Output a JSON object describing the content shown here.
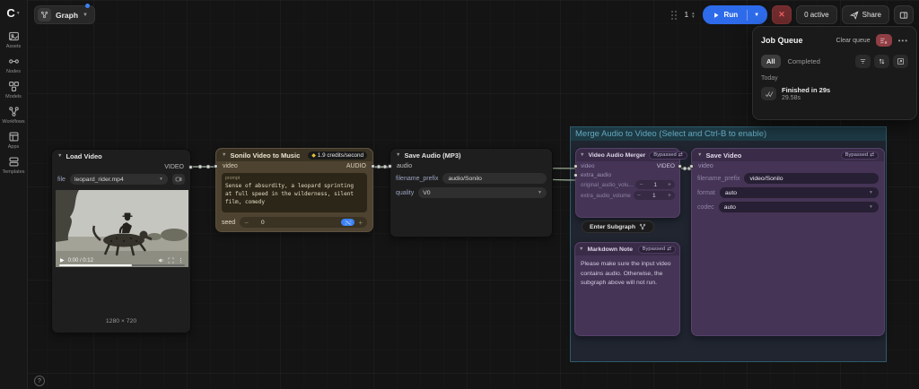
{
  "topbar": {
    "graph_tab": "Graph",
    "batch_count": "1",
    "run_label": "Run",
    "active_label": "0 active",
    "share_label": "Share"
  },
  "sidebar": {
    "items": [
      {
        "label": "Assets"
      },
      {
        "label": "Nodes"
      },
      {
        "label": "Models"
      },
      {
        "label": "Workflows"
      },
      {
        "label": "Apps"
      },
      {
        "label": "Templates"
      }
    ]
  },
  "job_queue": {
    "title": "Job Queue",
    "clear_label": "Clear queue",
    "tab_all": "All",
    "tab_completed": "Completed",
    "section_label": "Today",
    "item_title": "Finished in 29s",
    "item_duration": "29.58s"
  },
  "canvas": {
    "group_title": "Merge Audio to Video (Select and Ctrl-B to enable)"
  },
  "nodes": {
    "load_video": {
      "title": "Load Video",
      "output_label": "VIDEO",
      "file_label": "file",
      "file_value": "leopard_rider.mp4",
      "player_time": "0:00 / 0:12",
      "resolution": "1280 × 720"
    },
    "sonilo": {
      "title": "Sonilo Video to Music",
      "badge": "1.9 credits/second",
      "input_label": "video",
      "output_label": "AUDIO",
      "prompt_label": "prompt",
      "prompt_value": "Sense of absurdity, a leopard sprinting at full speed in the wilderness, silent film, comedy",
      "seed_label": "seed",
      "seed_value": "0"
    },
    "save_audio": {
      "title": "Save Audio (MP3)",
      "input_label": "audio",
      "filename_label": "filename_prefix",
      "filename_value": "audio/Sonilo",
      "quality_label": "quality",
      "quality_value": "V0"
    },
    "merger": {
      "title": "Video Audio Merger",
      "bypassed_label": "Bypassed",
      "input1": "video",
      "input2": "extra_audio",
      "output_label": "VIDEO",
      "widget1_label": "original_audio_volu...",
      "widget1_value": "1",
      "widget2_label": "extra_audio_volume",
      "widget2_value": "1",
      "enter_subgraph_label": "Enter Subgraph"
    },
    "note": {
      "title": "Markdown Note",
      "bypassed_label": "Bypassed",
      "text": "Please make sure the input video contains audio. Otherwise, the subgraph above will not run."
    },
    "save_video": {
      "title": "Save Video",
      "bypassed_label": "Bypassed",
      "input_label": "video",
      "filename_label": "filename_prefix",
      "filename_value": "video/Sonilo",
      "format_label": "format",
      "format_value": "auto",
      "codec_label": "codec",
      "codec_value": "auto"
    }
  },
  "colors": {
    "accent_blue": "#2e6bea",
    "api_node_brown": "#4e4330",
    "bypassed_purple": "#453455",
    "group_teal": "#63a8bc",
    "danger_red": "#8f3e44"
  }
}
